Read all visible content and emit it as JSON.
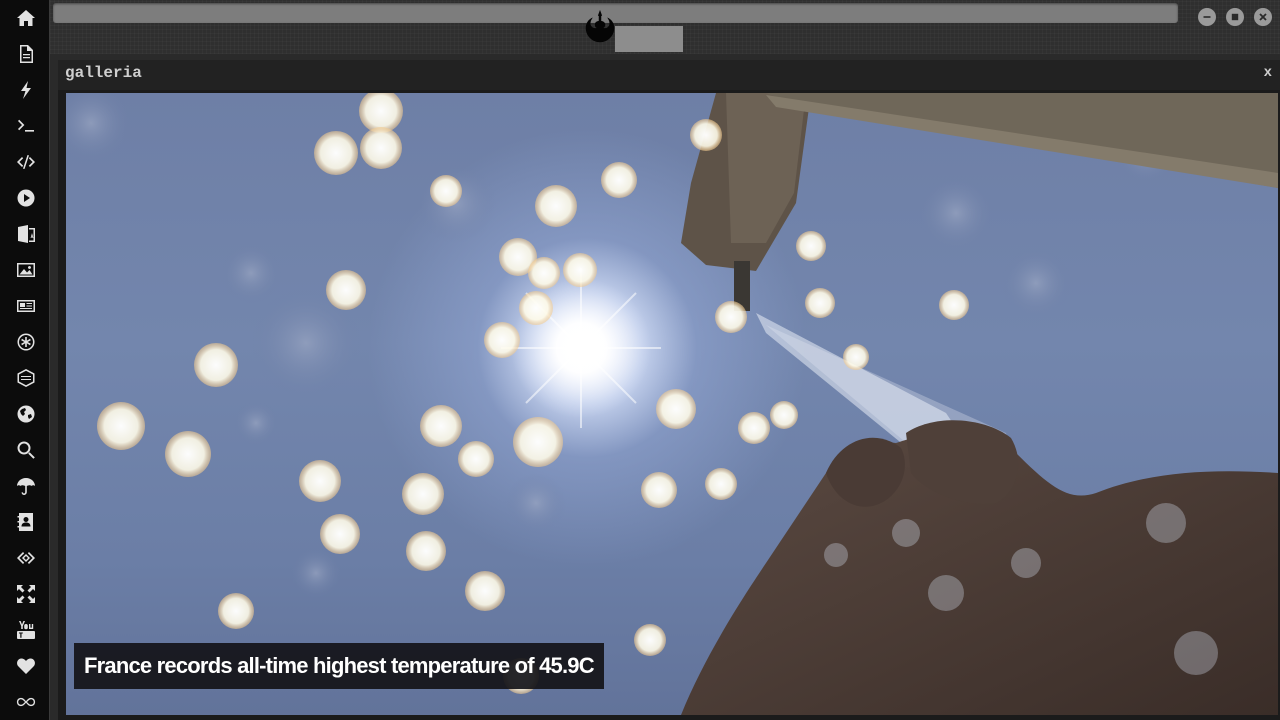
{
  "sidebar": {
    "items": [
      {
        "icon": "home-icon"
      },
      {
        "icon": "document-icon"
      },
      {
        "icon": "lightning-icon"
      },
      {
        "icon": "terminal-icon"
      },
      {
        "icon": "code-icon"
      },
      {
        "icon": "play-icon"
      },
      {
        "icon": "translate-icon"
      },
      {
        "icon": "image-icon"
      },
      {
        "icon": "newspaper-icon"
      },
      {
        "icon": "asterisk-icon"
      },
      {
        "icon": "hexagon-icon"
      },
      {
        "icon": "globe-icon"
      },
      {
        "icon": "search-icon"
      },
      {
        "icon": "umbrella-icon"
      },
      {
        "icon": "contacts-icon"
      },
      {
        "icon": "embed-icon"
      },
      {
        "icon": "expand-icon"
      },
      {
        "icon": "youtube-icon"
      },
      {
        "icon": "heart-icon"
      },
      {
        "icon": "infinity-icon"
      }
    ]
  },
  "topbar": {
    "logo_icon": "rebel-alliance-icon",
    "window_buttons": [
      "minimize-icon",
      "maximize-icon",
      "close-icon"
    ]
  },
  "gallery": {
    "title": "galleria",
    "close_label": "x",
    "caption": "France records all-time highest temperature of 45.9C"
  },
  "colors": {
    "sidebar_bg": "#0c0c0c",
    "topbar_bg": "#2f2f2f",
    "window_bg": "#1b1b1b",
    "icon": "#e2e2e2"
  }
}
